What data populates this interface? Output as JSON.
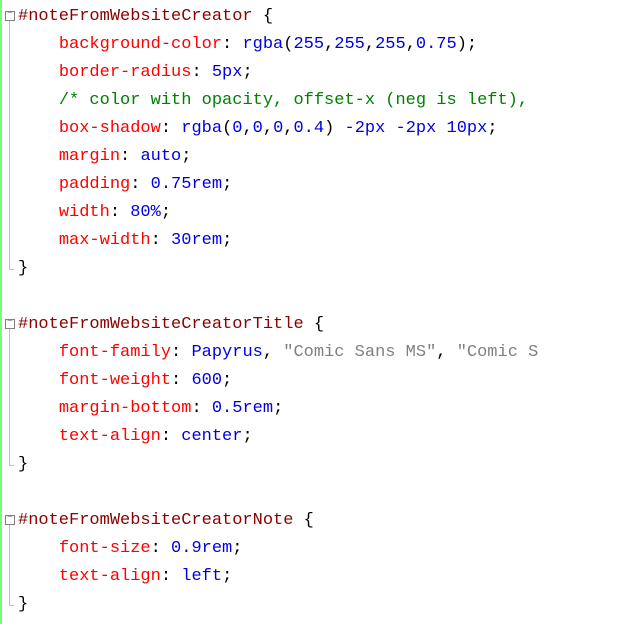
{
  "rules": [
    {
      "selector": "#noteFromWebsiteCreator",
      "decls": [
        {
          "kind": "decl",
          "prop": "background-color",
          "valueParts": [
            {
              "t": "func",
              "v": "rgba"
            },
            {
              "t": "punct",
              "v": "("
            },
            {
              "t": "num",
              "v": "255"
            },
            {
              "t": "punct",
              "v": ","
            },
            {
              "t": "num",
              "v": "255"
            },
            {
              "t": "punct",
              "v": ","
            },
            {
              "t": "num",
              "v": "255"
            },
            {
              "t": "punct",
              "v": ","
            },
            {
              "t": "num",
              "v": "0.75"
            },
            {
              "t": "punct",
              "v": ")"
            }
          ]
        },
        {
          "kind": "decl",
          "prop": "border-radius",
          "valueParts": [
            {
              "t": "num",
              "v": "5px"
            }
          ]
        },
        {
          "kind": "comment",
          "text": "/* color with opacity, offset-x (neg is left),"
        },
        {
          "kind": "decl",
          "prop": "box-shadow",
          "valueParts": [
            {
              "t": "func",
              "v": "rgba"
            },
            {
              "t": "punct",
              "v": "("
            },
            {
              "t": "num",
              "v": "0"
            },
            {
              "t": "punct",
              "v": ","
            },
            {
              "t": "num",
              "v": "0"
            },
            {
              "t": "punct",
              "v": ","
            },
            {
              "t": "num",
              "v": "0"
            },
            {
              "t": "punct",
              "v": ","
            },
            {
              "t": "num",
              "v": "0.4"
            },
            {
              "t": "punct",
              "v": ")"
            },
            {
              "t": "plain",
              "v": " "
            },
            {
              "t": "num",
              "v": "-2px"
            },
            {
              "t": "plain",
              "v": " "
            },
            {
              "t": "num",
              "v": "-2px"
            },
            {
              "t": "plain",
              "v": " "
            },
            {
              "t": "num",
              "v": "10px"
            }
          ]
        },
        {
          "kind": "decl",
          "prop": "margin",
          "valueParts": [
            {
              "t": "kw",
              "v": "auto"
            }
          ]
        },
        {
          "kind": "decl",
          "prop": "padding",
          "valueParts": [
            {
              "t": "num",
              "v": "0.75rem"
            }
          ]
        },
        {
          "kind": "decl",
          "prop": "width",
          "valueParts": [
            {
              "t": "num",
              "v": "80%"
            }
          ]
        },
        {
          "kind": "decl",
          "prop": "max-width",
          "valueParts": [
            {
              "t": "num",
              "v": "30rem"
            }
          ]
        }
      ]
    },
    {
      "selector": "#noteFromWebsiteCreatorTitle",
      "decls": [
        {
          "kind": "decl",
          "prop": "font-family",
          "valueParts": [
            {
              "t": "kw",
              "v": "Papyrus"
            },
            {
              "t": "punct",
              "v": ","
            },
            {
              "t": "plain",
              "v": " "
            },
            {
              "t": "str",
              "v": "\"Comic Sans MS\""
            },
            {
              "t": "punct",
              "v": ","
            },
            {
              "t": "plain",
              "v": " "
            },
            {
              "t": "str",
              "v": "\"Comic S"
            }
          ],
          "noSemicolon": true
        },
        {
          "kind": "decl",
          "prop": "font-weight",
          "valueParts": [
            {
              "t": "num",
              "v": "600"
            }
          ]
        },
        {
          "kind": "decl",
          "prop": "margin-bottom",
          "valueParts": [
            {
              "t": "num",
              "v": "0.5rem"
            }
          ]
        },
        {
          "kind": "decl",
          "prop": "text-align",
          "valueParts": [
            {
              "t": "kw",
              "v": "center"
            }
          ]
        }
      ]
    },
    {
      "selector": "#noteFromWebsiteCreatorNote",
      "decls": [
        {
          "kind": "decl",
          "prop": "font-size",
          "valueParts": [
            {
              "t": "num",
              "v": "0.9rem"
            }
          ]
        },
        {
          "kind": "decl",
          "prop": "text-align",
          "valueParts": [
            {
              "t": "kw",
              "v": "left"
            }
          ]
        }
      ]
    }
  ]
}
